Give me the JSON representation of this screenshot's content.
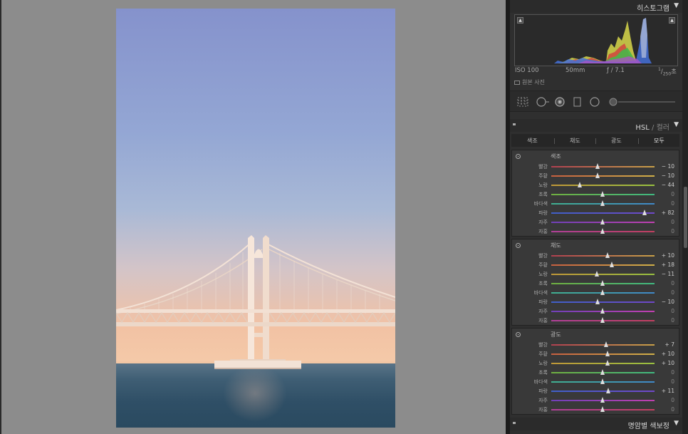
{
  "histogram": {
    "title": "히스토그램",
    "iso": "ISO 100",
    "focal": "50mm",
    "aperture": "ƒ / 7.1",
    "shutter_num": "1",
    "shutter_den": "250",
    "shutter_unit": "초",
    "original_label": "원본 사진"
  },
  "hsl": {
    "title": "HSL",
    "title_sep": " / ",
    "title_alt": "컬러",
    "tabs": [
      "색조",
      "채도",
      "광도",
      "모두"
    ],
    "colors": [
      "빨강",
      "주황",
      "노랑",
      "초록",
      "바다색",
      "파랑",
      "자주",
      "자홍"
    ],
    "groups": [
      {
        "title": "색조",
        "values": [
          "− 10",
          "− 10",
          "− 44",
          "0",
          "0",
          "+ 82",
          "0",
          "0"
        ],
        "levels": [
          -10,
          -10,
          -44,
          0,
          0,
          82,
          0,
          0
        ]
      },
      {
        "title": "채도",
        "values": [
          "+ 10",
          "+ 18",
          "− 11",
          "0",
          "0",
          "− 10",
          "0",
          "0"
        ],
        "levels": [
          10,
          18,
          -11,
          0,
          0,
          -10,
          0,
          0
        ]
      },
      {
        "title": "광도",
        "values": [
          "+ 7",
          "+ 10",
          "+ 10",
          "0",
          "0",
          "+ 11",
          "0",
          "0"
        ],
        "levels": [
          7,
          10,
          10,
          0,
          0,
          11,
          0,
          0
        ]
      }
    ]
  },
  "split_toning": {
    "title": "명암별 색보정"
  },
  "icons": {
    "collapse": "triangle-down-icon",
    "clip_shadow": "shadow-clipping-icon",
    "clip_highlight": "highlight-clipping-icon",
    "tools": [
      "crop-grid-icon",
      "spot-removal-icon",
      "red-eye-icon",
      "graduated-filter-icon",
      "radial-filter-icon",
      "adjustment-brush-icon"
    ]
  },
  "colors": {
    "panel": "#2f2f2f",
    "canvas": "#8c8c8c",
    "track_gradients": {
      "hue": [
        "#c0445a,#d6a04a",
        "#c86048,#d8c050",
        "#c8a040,#a8d048",
        "#88c048,#48c890",
        "#48c098,#4890d8",
        "#4868d8,#8048d8",
        "#8048c8,#d048c0",
        "#c048a8,#d04868"
      ]
    }
  }
}
